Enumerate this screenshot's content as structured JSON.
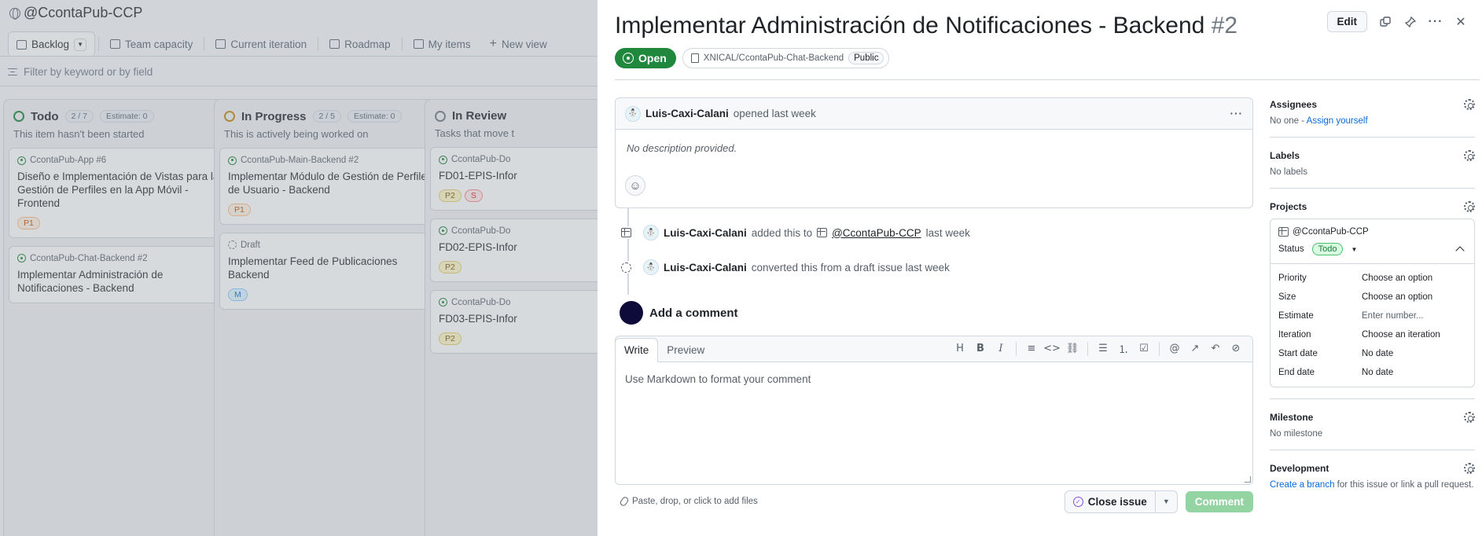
{
  "board": {
    "title": "@CcontaPub-CCP",
    "views": [
      {
        "label": "Backlog",
        "icon": "board-icon",
        "active": true
      },
      {
        "label": "Team capacity",
        "icon": "table-icon"
      },
      {
        "label": "Current iteration",
        "icon": "table-icon"
      },
      {
        "label": "Roadmap",
        "icon": "roadmap-icon"
      },
      {
        "label": "My items",
        "icon": "table-icon"
      },
      {
        "label": "New view",
        "icon": "plus-icon"
      }
    ],
    "filter_placeholder": "Filter by keyword or by field",
    "columns": [
      {
        "name": "Todo",
        "count": "2 / 7",
        "estimate": "Estimate: 0",
        "desc": "This item hasn't been started",
        "color": "#1a7f37",
        "cards": [
          {
            "repo": "CcontaPub-App #6",
            "title": "Diseño e Implementación de Vistas para la Gestión de Perfiles en la App Móvil - Frontend",
            "labels": [
              "P1"
            ]
          },
          {
            "repo": "CcontaPub-Chat-Backend #2",
            "title": "Implementar Administración de Notificaciones - Backend",
            "labels": []
          }
        ]
      },
      {
        "name": "In Progress",
        "count": "2 / 5",
        "estimate": "Estimate: 0",
        "desc": "This is actively being worked on",
        "color": "#bf8700",
        "cards": [
          {
            "repo": "CcontaPub-Main-Backend #2",
            "title": "Implementar Módulo de Gestión de Perfiles de Usuario - Backend",
            "labels": [
              "P1"
            ]
          },
          {
            "repo": "Draft",
            "title": "Implementar Feed de Publicaciones Backend",
            "labels": [
              "M"
            ]
          }
        ]
      },
      {
        "name": "In Review",
        "desc": "Tasks that move t",
        "color": "#57606a",
        "cards": [
          {
            "repo": "CcontaPub-Do",
            "title": "FD01-EPIS-Infor",
            "labels": [
              "P2",
              "S"
            ]
          },
          {
            "repo": "CcontaPub-Do",
            "title": "FD02-EPIS-Infor",
            "labels": [
              "P2"
            ]
          },
          {
            "repo": "CcontaPub-Do",
            "title": "FD03-EPIS-Infor",
            "labels": [
              "P2"
            ]
          }
        ]
      }
    ]
  },
  "issue": {
    "title": "Implementar Administración de Notificaciones - Backend",
    "number": "#2",
    "edit_label": "Edit",
    "state": "Open",
    "repo": "XNICAL/CcontaPub-Chat-Backend",
    "visibility": "Public",
    "comment": {
      "author": "Luis-Caxi-Calani",
      "meta": "opened last week",
      "body": "No description provided."
    },
    "timeline": [
      {
        "author": "Luis-Caxi-Calani",
        "pre": "added this to",
        "project": "@CcontaPub-CCP",
        "post": "last week"
      },
      {
        "author": "Luis-Caxi-Calani",
        "pre": "converted this from a draft issue last week"
      }
    ],
    "add_comment_label": "Add a comment",
    "editor": {
      "tab_write": "Write",
      "tab_preview": "Preview",
      "placeholder": "Use Markdown to format your comment",
      "attach_hint": "Paste, drop, or click to add files",
      "close_label": "Close issue",
      "comment_label": "Comment"
    }
  },
  "sidebar": {
    "assignees": {
      "label": "Assignees",
      "value_prefix": "No one - ",
      "link": "Assign yourself"
    },
    "labels": {
      "label": "Labels",
      "value": "No labels"
    },
    "projects": {
      "label": "Projects",
      "project_name": "@CcontaPub-CCP",
      "status_label": "Status",
      "status_value": "Todo",
      "fields": [
        {
          "key": "Priority",
          "value": "Choose an option"
        },
        {
          "key": "Size",
          "value": "Choose an option"
        },
        {
          "key": "Estimate",
          "value": "Enter number..."
        },
        {
          "key": "Iteration",
          "value": "Choose an iteration"
        },
        {
          "key": "Start date",
          "value": "No date"
        },
        {
          "key": "End date",
          "value": "No date"
        }
      ]
    },
    "milestone": {
      "label": "Milestone",
      "value": "No milestone"
    },
    "development": {
      "label": "Development",
      "link": "Create a branch",
      "value_suffix": " for this issue or link a pull request."
    }
  }
}
